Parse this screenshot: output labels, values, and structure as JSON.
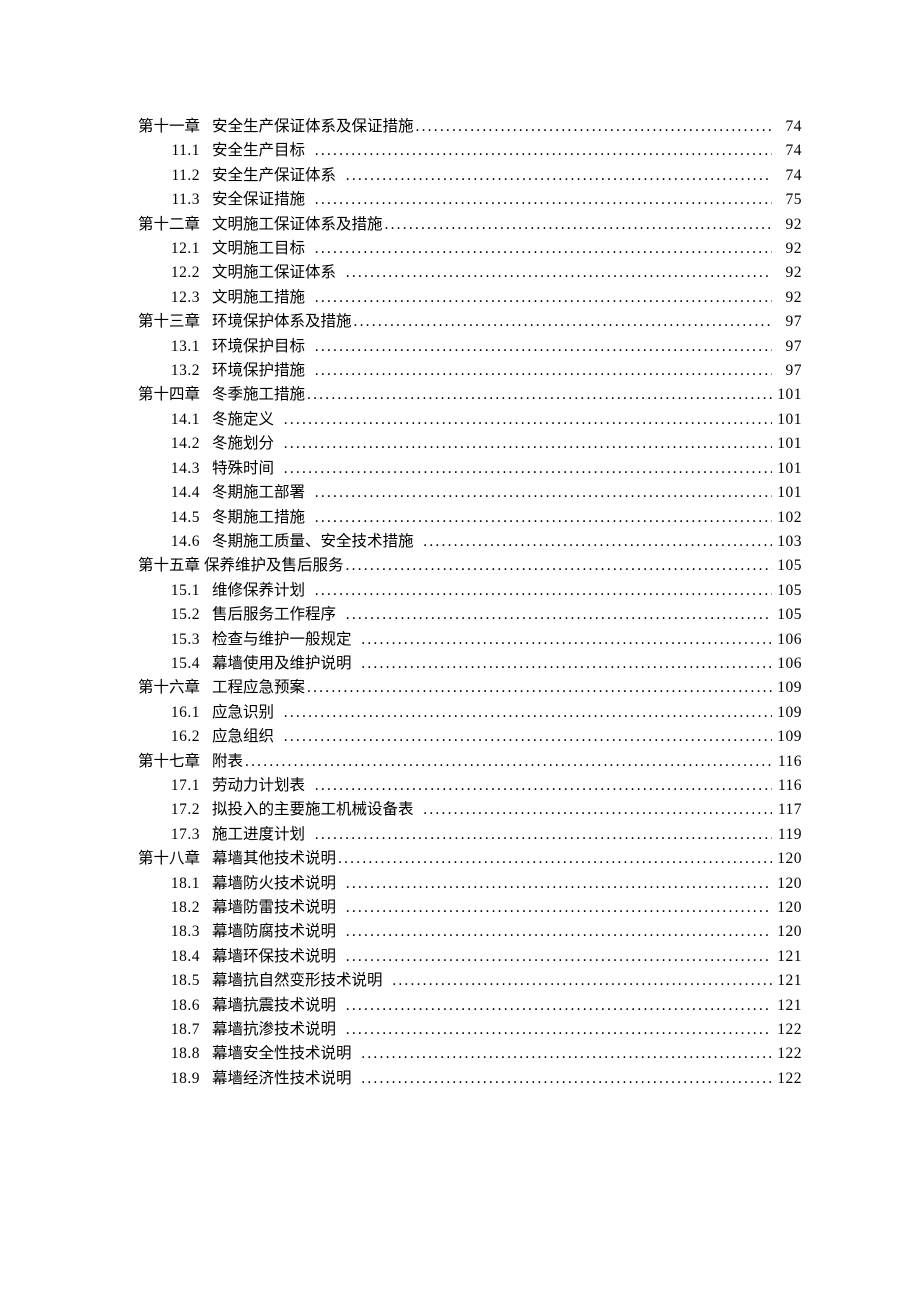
{
  "toc": [
    {
      "type": "chapter",
      "num": "第十一章",
      "title": "安全生产保证体系及保证措施",
      "page": "74"
    },
    {
      "type": "section",
      "num": "11.1",
      "title": "安全生产目标",
      "page": "74",
      "pad": true
    },
    {
      "type": "section",
      "num": "11.2",
      "title": "安全生产保证体系",
      "page": "74",
      "pad": true
    },
    {
      "type": "section",
      "num": "11.3",
      "title": "安全保证措施",
      "page": "75",
      "pad": true
    },
    {
      "type": "chapter",
      "num": "第十二章",
      "title": "文明施工保证体系及措施",
      "page": "92"
    },
    {
      "type": "section",
      "num": "12.1",
      "title": "文明施工目标",
      "page": "92",
      "pad": true
    },
    {
      "type": "section",
      "num": "12.2",
      "title": "文明施工保证体系",
      "page": "92",
      "pad": true
    },
    {
      "type": "section",
      "num": "12.3",
      "title": "文明施工措施",
      "page": "92",
      "pad": true
    },
    {
      "type": "chapter",
      "num": "第十三章",
      "title": "环境保护体系及措施",
      "page": "97"
    },
    {
      "type": "section",
      "num": "13.1",
      "title": "环境保护目标",
      "page": "97",
      "pad": true
    },
    {
      "type": "section",
      "num": "13.2",
      "title": "环境保护措施",
      "page": "97",
      "pad": true
    },
    {
      "type": "chapter",
      "num": "第十四章",
      "title": "冬季施工措施",
      "page": "101"
    },
    {
      "type": "section",
      "num": "14.1",
      "title": "冬施定义",
      "page": "101",
      "pad": true
    },
    {
      "type": "section",
      "num": "14.2",
      "title": "冬施划分",
      "page": "101",
      "pad": true
    },
    {
      "type": "section",
      "num": "14.3",
      "title": "特殊时间",
      "page": "101",
      "pad": true
    },
    {
      "type": "section",
      "num": "14.4",
      "title": "冬期施工部署",
      "page": "101",
      "pad": true
    },
    {
      "type": "section",
      "num": "14.5",
      "title": "冬期施工措施",
      "page": "102",
      "pad": true
    },
    {
      "type": "section",
      "num": "14.6",
      "title": "冬期施工质量、安全技术措施",
      "page": "103",
      "pad": true
    },
    {
      "type": "chapter",
      "num": "第十五章",
      "title": "保养维护及售后服务",
      "page": "105",
      "nogap": true
    },
    {
      "type": "section",
      "num": "15.1",
      "title": "维修保养计划",
      "page": "105",
      "pad": true
    },
    {
      "type": "section",
      "num": "15.2",
      "title": "售后服务工作程序",
      "page": "105",
      "pad": true
    },
    {
      "type": "section",
      "num": "15.3",
      "title": "检查与维护一般规定",
      "page": "106",
      "pad": true
    },
    {
      "type": "section",
      "num": "15.4",
      "title": "幕墙使用及维护说明",
      "page": "106",
      "pad": true
    },
    {
      "type": "chapter",
      "num": "第十六章",
      "title": "工程应急预案",
      "page": "109"
    },
    {
      "type": "section",
      "num": "16.1",
      "title": "应急识别",
      "page": "109",
      "pad": true
    },
    {
      "type": "section",
      "num": "16.2",
      "title": "应急组织",
      "page": "109",
      "pad": true
    },
    {
      "type": "chapter",
      "num": "第十七章",
      "title": "附表",
      "page": "116"
    },
    {
      "type": "section",
      "num": "17.1",
      "title": "劳动力计划表",
      "page": "116",
      "pad": true
    },
    {
      "type": "section",
      "num": "17.2",
      "title": "拟投入的主要施工机械设备表",
      "page": "117",
      "pad": true
    },
    {
      "type": "section",
      "num": "17.3",
      "title": "施工进度计划",
      "page": "119",
      "pad": true
    },
    {
      "type": "chapter",
      "num": "第十八章",
      "title": "幕墙其他技术说明",
      "page": "120"
    },
    {
      "type": "section",
      "num": "18.1",
      "title": "幕墙防火技术说明",
      "page": "120",
      "pad": true
    },
    {
      "type": "section",
      "num": "18.2",
      "title": "幕墙防雷技术说明",
      "page": "120",
      "pad": true
    },
    {
      "type": "section",
      "num": "18.3",
      "title": "幕墙防腐技术说明",
      "page": "120",
      "pad": true
    },
    {
      "type": "section",
      "num": "18.4",
      "title": "幕墙环保技术说明",
      "page": "121",
      "pad": true
    },
    {
      "type": "section",
      "num": "18.5",
      "title": "幕墙抗自然变形技术说明",
      "page": "121",
      "pad": true
    },
    {
      "type": "section",
      "num": "18.6",
      "title": "幕墙抗震技术说明",
      "page": "121",
      "pad": true
    },
    {
      "type": "section",
      "num": "18.7",
      "title": "幕墙抗渗技术说明",
      "page": "122",
      "pad": true
    },
    {
      "type": "section",
      "num": "18.8",
      "title": "幕墙安全性技术说明",
      "page": "122",
      "pad": true
    },
    {
      "type": "section",
      "num": "18.9",
      "title": "幕墙经济性技术说明",
      "page": "122",
      "pad": true
    }
  ]
}
